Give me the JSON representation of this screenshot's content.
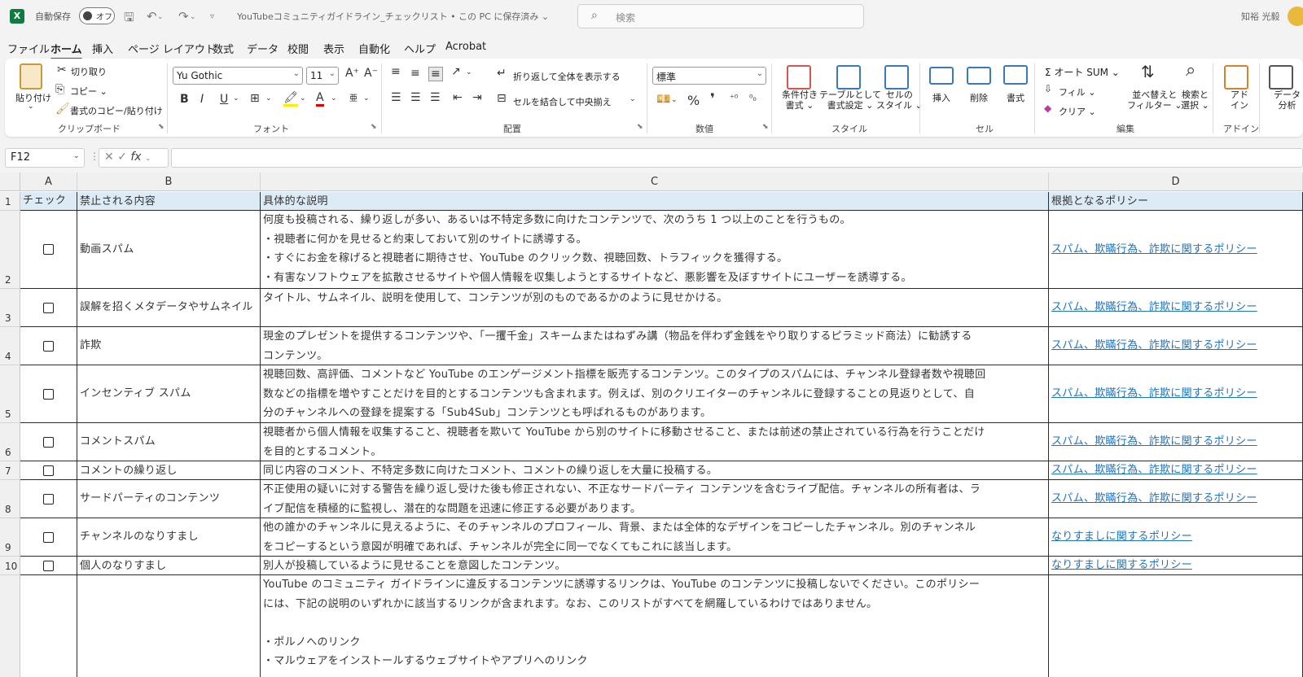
{
  "titlebar": {
    "app_icon": "X",
    "autosave_label": "自動保存",
    "autosave_state": "オフ",
    "doc_title": "YouTubeコミュニティガイドライン_チェックリスト • この PC に保存済み ⌄",
    "search_placeholder": "検索",
    "user_name": "知裕 光毅",
    "icons": [
      "save-icon",
      "undo-icon",
      "redo-icon",
      "customize-icon"
    ]
  },
  "menubar": {
    "items": [
      "ファイル",
      "ホーム",
      "挿入",
      "ページ レイアウト",
      "数式",
      "データ",
      "校閲",
      "表示",
      "自動化",
      "ヘルプ",
      "Acrobat"
    ],
    "active": "ホーム"
  },
  "ribbon": {
    "clipboard": {
      "paste": "貼り付け",
      "cut": "切り取り",
      "copy": "コピー ⌄",
      "format_painter": "書式のコピー/貼り付け",
      "group": "クリップボード"
    },
    "font": {
      "name": "Yu Gothic",
      "size": "11",
      "grow": "A⁺",
      "shrink": "A⁻",
      "bold": "B",
      "italic": "I",
      "underline": "U",
      "group": "フォント"
    },
    "alignment": {
      "wrap": "折り返して全体を表示する",
      "merge": "セルを結合して中央揃え",
      "group": "配置"
    },
    "number": {
      "format": "標準",
      "percent": "%",
      "comma": "❜",
      "group": "数値"
    },
    "styles": {
      "conditional": "条件付き\n書式 ⌄",
      "table": "テーブルとして\n書式設定 ⌄",
      "cell_styles": "セルの\nスタイル ⌄",
      "group": "スタイル"
    },
    "cells": {
      "insert": "挿入",
      "delete": "削除",
      "format": "書式",
      "group": "セル"
    },
    "editing": {
      "autosum": "Σ オート SUM ⌄",
      "fill": "フィル ⌄",
      "clear": "クリア ⌄",
      "sort": "並べ替えと\nフィルター ⌄",
      "find": "検索と\n選択 ⌄",
      "group": "編集"
    },
    "addins": {
      "addin": "アド\nイン",
      "group": "アドイン"
    },
    "analyze": {
      "label": "データ\n分析"
    }
  },
  "formula_bar": {
    "name_box": "F12",
    "fx": "fx",
    "value": ""
  },
  "columns": [
    "A",
    "B",
    "C",
    "D"
  ],
  "rows": [
    {
      "num": "1",
      "header": true,
      "a": "チェック",
      "b": "禁止される内容",
      "c": [
        "具体的な説明"
      ],
      "d": "根拠となるポリシー"
    },
    {
      "num": "2",
      "b": "動画スパム",
      "c": [
        "何度も投稿される、繰り返しが多い、あるいは不特定多数に向けたコンテンツで、次のうち 1 つ以上のことを行うもの。",
        "・視聴者に何かを見せると約束しておいて別のサイトに誘導する。",
        "・すぐにお金を稼げると視聴者に期待させ、YouTube のクリック数、視聴回数、トラフィックを獲得する。",
        "・有害なソフトウェアを拡散させるサイトや個人情報を収集しようとするサイトなど、悪影響を及ぼすサイトにユーザーを誘導する。"
      ],
      "d": "スパム、欺瞞行為、詐欺に関するポリシー"
    },
    {
      "num": "3",
      "b": "誤解を招くメタデータやサムネイル",
      "c": [
        "タイトル、サムネイル、説明を使用して、コンテンツが別のものであるかのように見せかける。"
      ],
      "d": "スパム、欺瞞行為、詐欺に関するポリシー"
    },
    {
      "num": "4",
      "b": "詐欺",
      "c": [
        "現金のプレゼントを提供するコンテンツや、「一攫千金」スキームまたはねずみ講（物品を伴わず金銭をやり取りするピラミッド商法）に勧誘する",
        "コンテンツ。"
      ],
      "d": "スパム、欺瞞行為、詐欺に関するポリシー"
    },
    {
      "num": "5",
      "b": "インセンティブ スパム",
      "c": [
        "視聴回数、高評価、コメントなど YouTube のエンゲージメント指標を販売するコンテンツ。このタイプのスパムには、チャンネル登録者数や視聴回",
        "数などの指標を増やすことだけを目的とするコンテンツも含まれます。例えば、別のクリエイターのチャンネルに登録することの見返りとして、自",
        "分のチャンネルへの登録を提案する「Sub4Sub」コンテンツとも呼ばれるものがあります。"
      ],
      "d": "スパム、欺瞞行為、詐欺に関するポリシー"
    },
    {
      "num": "6",
      "b": "コメントスパム",
      "c": [
        "視聴者から個人情報を収集すること、視聴者を欺いて YouTube から別のサイトに移動させること、または前述の禁止されている行為を行うことだけ",
        "を目的とするコメント。"
      ],
      "d": "スパム、欺瞞行為、詐欺に関するポリシー"
    },
    {
      "num": "7",
      "b": "コメントの繰り返し",
      "c": [
        "同じ内容のコメント、不特定多数に向けたコメント、コメントの繰り返しを大量に投稿する。"
      ],
      "d": "スパム、欺瞞行為、詐欺に関するポリシー"
    },
    {
      "num": "8",
      "b": "サードパーティのコンテンツ",
      "c": [
        "不正使用の疑いに対する警告を繰り返し受けた後も修正されない、不正なサードパーティ コンテンツを含むライブ配信。チャンネルの所有者は、ラ",
        "イブ配信を積極的に監視し、潜在的な問題を迅速に修正する必要があります。"
      ],
      "d": "スパム、欺瞞行為、詐欺に関するポリシー"
    },
    {
      "num": "9",
      "b": "チャンネルのなりすまし",
      "c": [
        "他の誰かのチャンネルに見えるように、そのチャンネルのプロフィール、背景、または全体的なデザインをコピーしたチャンネル。別のチャンネル",
        "をコピーするという意図が明確であれば、チャンネルが完全に同一でなくてもこれに該当します。"
      ],
      "d": "なりすましに関するポリシー"
    },
    {
      "num": "10",
      "b": "個人のなりすまし",
      "c": [
        "別人が投稿しているように見せることを意図したコンテンツ。"
      ],
      "d": "なりすましに関するポリシー"
    },
    {
      "num": "",
      "b": "",
      "c": [
        "YouTube のコミュニティ ガイドラインに違反するコンテンツに誘導するリンクは、YouTube のコンテンツに投稿しないでください。このポリシー",
        "には、下記の説明のいずれかに該当するリンクが含まれます。なお、このリストがすべてを網羅しているわけではありません。",
        "",
        "・ポルノへのリンク",
        "・マルウェアをインストールするウェブサイトやアプリへのリンク"
      ],
      "d": ""
    }
  ]
}
